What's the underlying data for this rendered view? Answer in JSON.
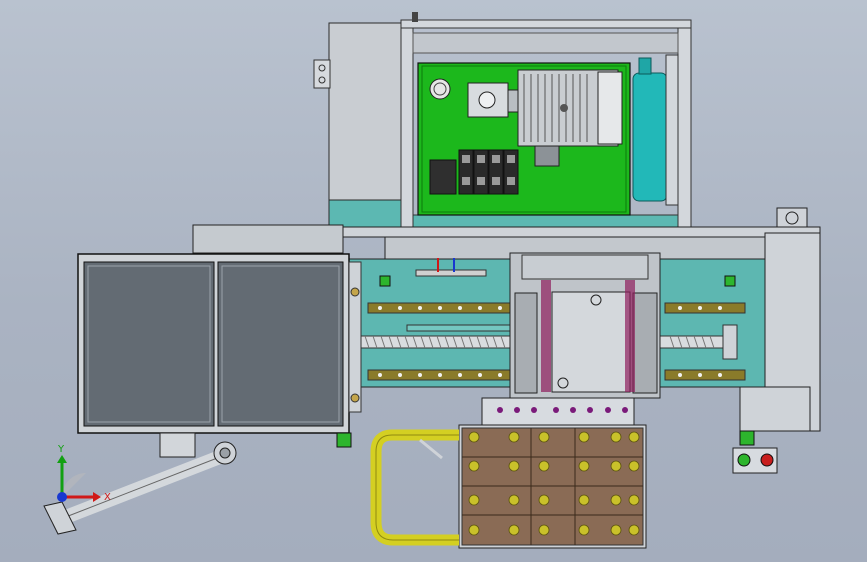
{
  "viewport": {
    "background_top": "#b9c2cf",
    "background_bottom": "#a4adbd"
  },
  "triad": {
    "x_label": "X",
    "y_label": "Y",
    "x_color": "#d01818",
    "y_color": "#12a012",
    "z_color": "#1838d0"
  },
  "colors": {
    "steel": "#cfd3d8",
    "teal_frame": "#5fbab5",
    "pcb_green": "#18b818",
    "copper_plate": "#8b6a52",
    "yellow_hose": "#d8d21e",
    "cyan_tank": "#1fb7b7"
  },
  "icons": [
    "coordinate-triad-icon",
    "start-button-icon",
    "stop-button-icon"
  ]
}
